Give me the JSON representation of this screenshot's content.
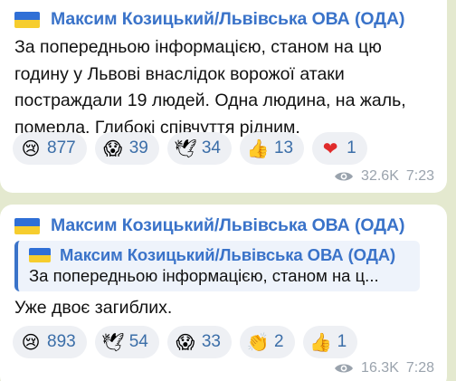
{
  "colors": {
    "background": "#e4e9cf",
    "sender": "#3a73c9",
    "reaction_count": "#3b6ea8",
    "meta": "#9aa3ad"
  },
  "messages": [
    {
      "sender": "Максим Козицький/Львівська ОВА (ОДА)",
      "text": "За попередньою інформацією, станом на цю годину у Львові внаслідок ворожої атаки постраждали 19 людей. Одна людина, на жаль, померла. Глибокі співчуття рідним.",
      "reactions": [
        {
          "icon": "crying-face-icon",
          "emoji": "😢",
          "count": "877"
        },
        {
          "icon": "screaming-face-icon",
          "emoji": "😱",
          "count": "39"
        },
        {
          "icon": "dove-icon",
          "emoji": "🕊",
          "count": "34"
        },
        {
          "icon": "thumbs-up-icon",
          "emoji": "👍",
          "count": "13"
        },
        {
          "icon": "heart-icon",
          "emoji": "❤",
          "count": "1"
        }
      ],
      "views": "32.6K",
      "time": "7:23"
    },
    {
      "sender": "Максим Козицький/Львівська ОВА (ОДА)",
      "quote": {
        "sender": "Максим Козицький/Львівська ОВА (ОДА)",
        "text": "За попередньою інформацією, станом на ц..."
      },
      "text": "Уже двоє загиблих.",
      "reactions": [
        {
          "icon": "crying-face-icon",
          "emoji": "😢",
          "count": "893"
        },
        {
          "icon": "dove-icon",
          "emoji": "🕊",
          "count": "54"
        },
        {
          "icon": "screaming-face-icon",
          "emoji": "😱",
          "count": "33"
        },
        {
          "icon": "clapping-hands-icon",
          "emoji": "👏",
          "count": "2"
        },
        {
          "icon": "thumbs-up-icon",
          "emoji": "👍",
          "count": "1"
        }
      ],
      "views": "16.3K",
      "time": "7:28"
    }
  ]
}
